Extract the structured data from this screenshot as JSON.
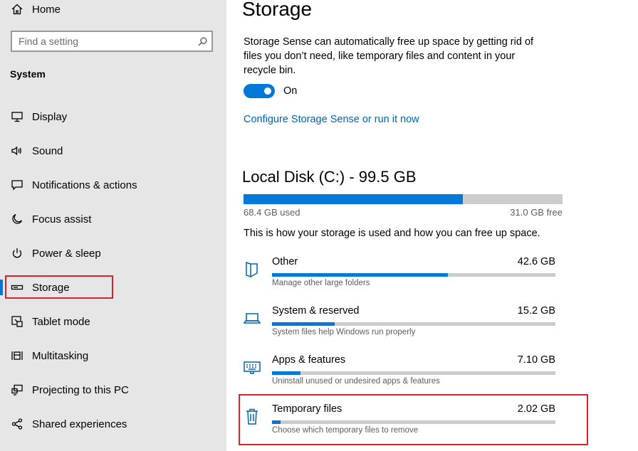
{
  "sidebar": {
    "home_label": "Home",
    "search_placeholder": "Find a setting",
    "section_heading": "System",
    "items": [
      {
        "label": "Display",
        "icon": "monitor-icon"
      },
      {
        "label": "Sound",
        "icon": "speaker-icon"
      },
      {
        "label": "Notifications & actions",
        "icon": "notification-icon"
      },
      {
        "label": "Focus assist",
        "icon": "moon-icon"
      },
      {
        "label": "Power & sleep",
        "icon": "power-icon"
      },
      {
        "label": "Storage",
        "icon": "drive-icon",
        "selected": true
      },
      {
        "label": "Tablet mode",
        "icon": "tablet-mode-icon"
      },
      {
        "label": "Multitasking",
        "icon": "multitasking-icon"
      },
      {
        "label": "Projecting to this PC",
        "icon": "projector-icon"
      },
      {
        "label": "Shared experiences",
        "icon": "share-icon"
      }
    ]
  },
  "main": {
    "title": "Storage",
    "sense_description": "Storage Sense can automatically free up space by getting rid of files you don’t need, like temporary files and content in your recycle bin.",
    "toggle": {
      "label": "On",
      "on": true
    },
    "configure_link": "Configure Storage Sense or run it now",
    "disk": {
      "title": "Local Disk (C:) - 99.5 GB",
      "used_label": "68.4 GB used",
      "free_label": "31.0 GB free",
      "used_fraction": 0.687
    },
    "how_text": "This is how your storage is used and how you can free up space.",
    "categories": [
      {
        "name": "Other",
        "size": "42.6 GB",
        "description": "Manage other large folders",
        "fraction": 0.62,
        "icon": "folder-icon"
      },
      {
        "name": "System & reserved",
        "size": "15.2 GB",
        "description": "System files help Windows run properly",
        "fraction": 0.22,
        "icon": "laptop-icon"
      },
      {
        "name": "Apps & features",
        "size": "7.10 GB",
        "description": "Uninstall unused or undesired apps & features",
        "fraction": 0.1,
        "icon": "keyboard-icon"
      },
      {
        "name": "Temporary files",
        "size": "2.02 GB",
        "description": "Choose which temporary files to remove",
        "fraction": 0.03,
        "icon": "trash-icon"
      }
    ]
  },
  "colors": {
    "accent": "#0078d7",
    "link": "#0063b1",
    "highlight": "#d9222e",
    "sidebar_bg": "#e6e6e6"
  }
}
